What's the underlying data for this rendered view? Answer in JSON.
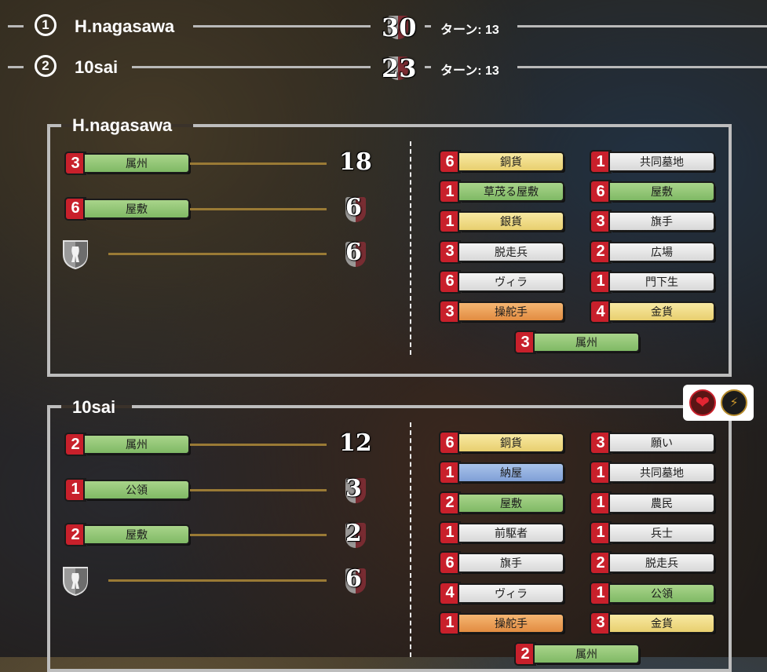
{
  "ranking": [
    {
      "rank": "1",
      "name": "H.nagasawa",
      "score": "30",
      "turns": "ターン: 13"
    },
    {
      "rank": "2",
      "name": "10sai",
      "score": "23",
      "turns": "ターン: 13"
    }
  ],
  "players": [
    {
      "name": "H.nagasawa",
      "categories": [
        {
          "count": "3",
          "label": "属州",
          "color": "green",
          "score": "18"
        },
        {
          "count": "6",
          "label": "屋敷",
          "color": "green",
          "score": "6"
        }
      ],
      "shield_score": "6",
      "deck_left": [
        {
          "count": "6",
          "label": "銅貨",
          "color": "yellow"
        },
        {
          "count": "1",
          "label": "草茂る屋敷",
          "color": "green"
        },
        {
          "count": "1",
          "label": "銀貨",
          "color": "yellow"
        },
        {
          "count": "3",
          "label": "脱走兵",
          "color": "white"
        },
        {
          "count": "6",
          "label": "ヴィラ",
          "color": "white"
        },
        {
          "count": "3",
          "label": "操舵手",
          "color": "orange"
        }
      ],
      "deck_right": [
        {
          "count": "1",
          "label": "共同墓地",
          "color": "white"
        },
        {
          "count": "6",
          "label": "屋敷",
          "color": "green"
        },
        {
          "count": "3",
          "label": "旗手",
          "color": "white"
        },
        {
          "count": "2",
          "label": "広場",
          "color": "white"
        },
        {
          "count": "1",
          "label": "門下生",
          "color": "white"
        },
        {
          "count": "4",
          "label": "金貨",
          "color": "yellow"
        }
      ],
      "deck_bottom": {
        "count": "3",
        "label": "属州",
        "color": "green"
      }
    },
    {
      "name": "10sai",
      "categories": [
        {
          "count": "2",
          "label": "属州",
          "color": "green",
          "score": "12"
        },
        {
          "count": "1",
          "label": "公領",
          "color": "green",
          "score": "3"
        },
        {
          "count": "2",
          "label": "屋敷",
          "color": "green",
          "score": "2"
        }
      ],
      "shield_score": "6",
      "deck_left": [
        {
          "count": "6",
          "label": "銅貨",
          "color": "yellow"
        },
        {
          "count": "1",
          "label": "納屋",
          "color": "blue"
        },
        {
          "count": "2",
          "label": "屋敷",
          "color": "green"
        },
        {
          "count": "1",
          "label": "前駆者",
          "color": "white"
        },
        {
          "count": "6",
          "label": "旗手",
          "color": "white"
        },
        {
          "count": "4",
          "label": "ヴィラ",
          "color": "white"
        },
        {
          "count": "1",
          "label": "操舵手",
          "color": "orange"
        }
      ],
      "deck_right": [
        {
          "count": "3",
          "label": "願い",
          "color": "white"
        },
        {
          "count": "1",
          "label": "共同墓地",
          "color": "white"
        },
        {
          "count": "1",
          "label": "農民",
          "color": "white"
        },
        {
          "count": "1",
          "label": "兵士",
          "color": "white"
        },
        {
          "count": "2",
          "label": "脱走兵",
          "color": "white"
        },
        {
          "count": "1",
          "label": "公領",
          "color": "green"
        },
        {
          "count": "3",
          "label": "金貨",
          "color": "yellow"
        }
      ],
      "deck_bottom": {
        "count": "2",
        "label": "属州",
        "color": "green"
      }
    }
  ],
  "icons": {
    "heart": "heart-icon",
    "bolt": "bolt-icon",
    "shield": "shield-icon"
  }
}
